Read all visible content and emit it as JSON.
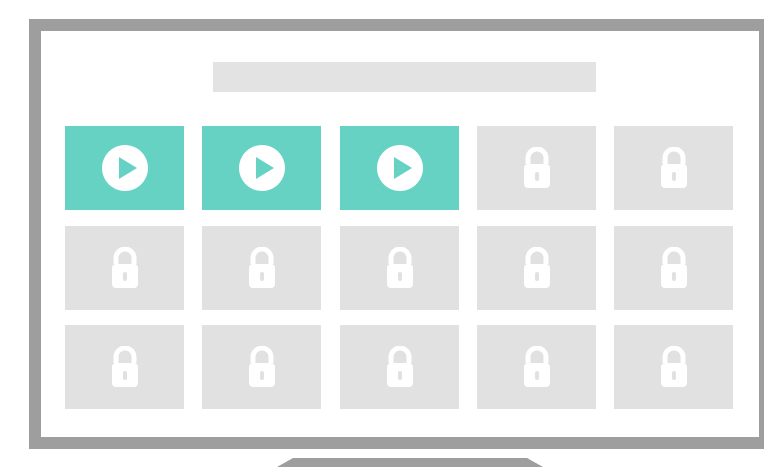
{
  "screen": {
    "title_placeholder": "",
    "tiles": [
      {
        "state": "unlocked",
        "icon": "play-icon"
      },
      {
        "state": "unlocked",
        "icon": "play-icon"
      },
      {
        "state": "unlocked",
        "icon": "play-icon"
      },
      {
        "state": "locked",
        "icon": "lock-icon"
      },
      {
        "state": "locked",
        "icon": "lock-icon"
      },
      {
        "state": "locked",
        "icon": "lock-icon"
      },
      {
        "state": "locked",
        "icon": "lock-icon"
      },
      {
        "state": "locked",
        "icon": "lock-icon"
      },
      {
        "state": "locked",
        "icon": "lock-icon"
      },
      {
        "state": "locked",
        "icon": "lock-icon"
      },
      {
        "state": "locked",
        "icon": "lock-icon"
      },
      {
        "state": "locked",
        "icon": "lock-icon"
      },
      {
        "state": "locked",
        "icon": "lock-icon"
      },
      {
        "state": "locked",
        "icon": "lock-icon"
      },
      {
        "state": "locked",
        "icon": "lock-icon"
      }
    ]
  },
  "colors": {
    "frame": "#9e9e9e",
    "unlocked_tile": "#66d2c4",
    "locked_tile": "#e1e1e1",
    "title_bar": "#e3e3e3",
    "icon": "#ffffff"
  }
}
